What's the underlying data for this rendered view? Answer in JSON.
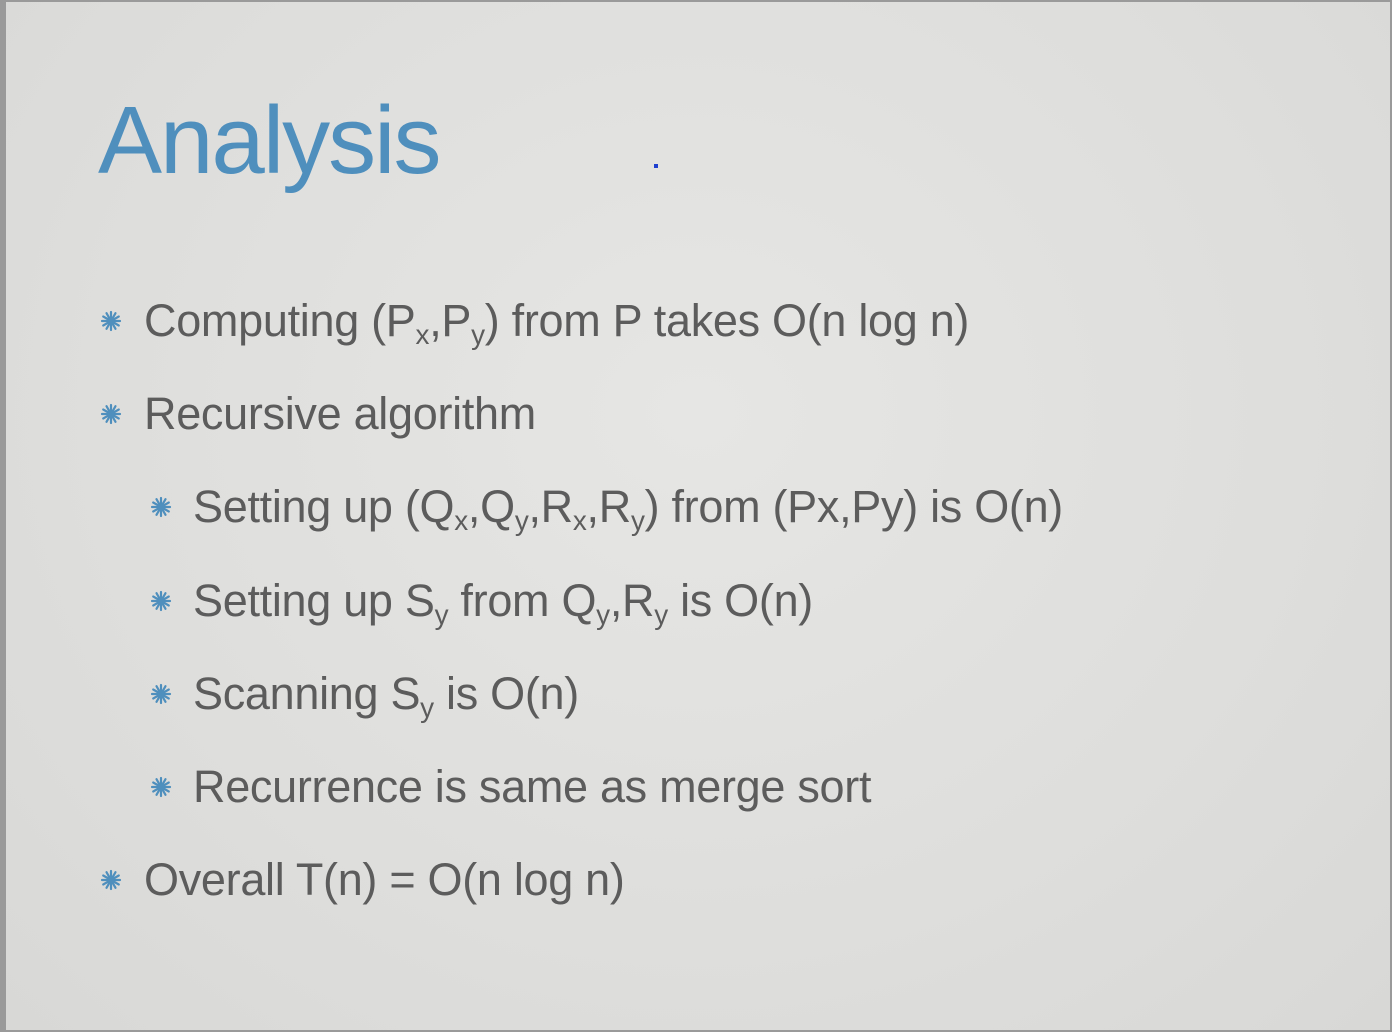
{
  "slide": {
    "title": "Analysis",
    "accent_color": "#4f8fbd",
    "text_color": "#5c5c5c",
    "bullet_icon": "asterisk-bullet-icon",
    "bullets": [
      {
        "level": 1,
        "parts": [
          {
            "text": "Computing (P"
          },
          {
            "sub": "x"
          },
          {
            "text": ",P"
          },
          {
            "sub": "y"
          },
          {
            "text": ") from P takes O(n log n)"
          }
        ]
      },
      {
        "level": 1,
        "parts": [
          {
            "text": "Recursive algorithm"
          }
        ]
      },
      {
        "level": 2,
        "parts": [
          {
            "text": "Setting up (Q"
          },
          {
            "sub": "x"
          },
          {
            "text": ",Q"
          },
          {
            "sub": "y"
          },
          {
            "text": ",R"
          },
          {
            "sub": "x"
          },
          {
            "text": ",R"
          },
          {
            "sub": "y"
          },
          {
            "text": ") from (Px,Py) is O(n)"
          }
        ]
      },
      {
        "level": 2,
        "parts": [
          {
            "text": "Setting up S"
          },
          {
            "sub": "y"
          },
          {
            "text": " from Q"
          },
          {
            "sub": "y"
          },
          {
            "text": ",R"
          },
          {
            "sub": "y"
          },
          {
            "text": " is O(n)"
          }
        ]
      },
      {
        "level": 2,
        "parts": [
          {
            "text": "Scanning S"
          },
          {
            "sub": "y"
          },
          {
            "text": " is O(n)"
          }
        ]
      },
      {
        "level": 2,
        "parts": [
          {
            "text": "Recurrence is same as merge sort"
          }
        ]
      },
      {
        "level": 1,
        "parts": [
          {
            "text": "Overall T(n) = O(n log n)"
          }
        ]
      }
    ]
  }
}
